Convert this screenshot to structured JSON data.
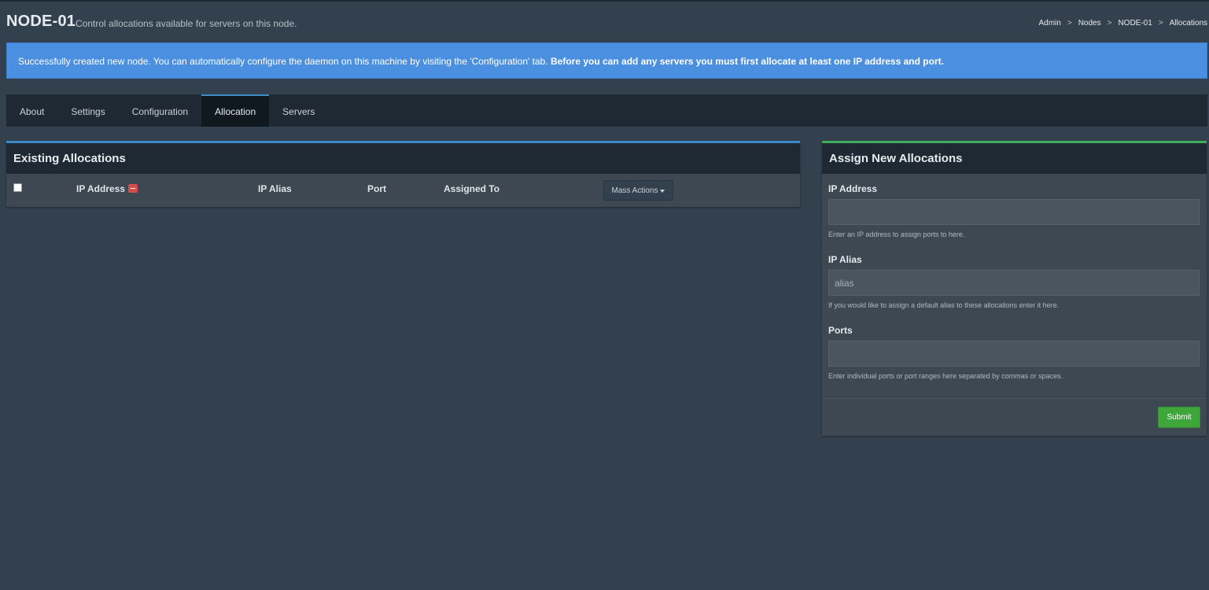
{
  "header": {
    "title": "NODE-01",
    "subtitle": "Control allocations available for servers on this node."
  },
  "breadcrumb": [
    "Admin",
    "Nodes",
    "NODE-01",
    "Allocations"
  ],
  "breadcrumb_separator": ">",
  "alert": {
    "text": "Successfully created new node. You can automatically configure the daemon on this machine by visiting the 'Configuration' tab.",
    "bold": "Before you can add any servers you must first allocate at least one IP address and port.",
    "color": "#4b8fe0"
  },
  "tabs": [
    {
      "label": "About",
      "active": false
    },
    {
      "label": "Settings",
      "active": false
    },
    {
      "label": "Configuration",
      "active": false
    },
    {
      "label": "Allocation",
      "active": true
    },
    {
      "label": "Servers",
      "active": false
    }
  ],
  "existing": {
    "title": "Existing Allocations",
    "columns": {
      "ip_address": "IP Address",
      "ip_alias": "IP Alias",
      "port": "Port",
      "assigned_to": "Assigned To"
    },
    "mass_actions": "Mass Actions",
    "accent": "#3e8cc6"
  },
  "assign": {
    "title": "Assign New Allocations",
    "ip_label": "IP Address",
    "ip_value": "",
    "ip_help": "Enter an IP address to assign ports to here.",
    "alias_label": "IP Alias",
    "alias_placeholder": "alias",
    "alias_help": "If you would like to assign a default alias to these allocations enter it here.",
    "ports_label": "Ports",
    "ports_value": "",
    "ports_help": "Enter individual ports or port ranges here separated by commas or spaces.",
    "submit": "Submit",
    "accent": "#3fae5c"
  }
}
